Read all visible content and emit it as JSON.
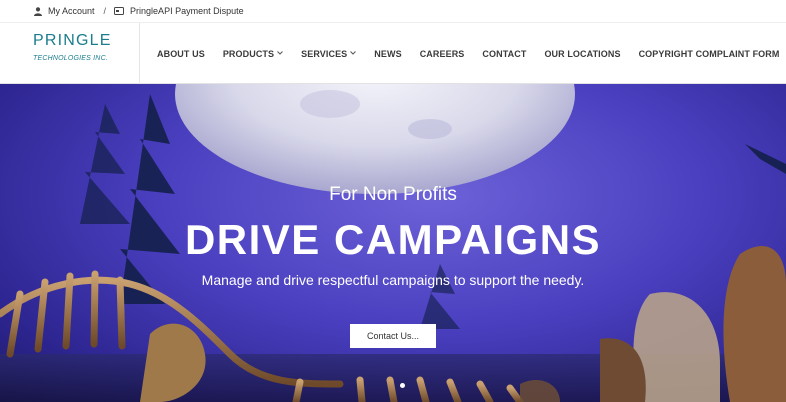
{
  "topbar": {
    "account_label": "My Account",
    "separator": "/",
    "dispute_label": "PringleAPI Payment Dispute"
  },
  "logo": {
    "brand": "PRINGLE",
    "sub": "TECHNOLOGIES INC."
  },
  "nav": {
    "items": [
      {
        "label": "ABOUT US",
        "dropdown": false
      },
      {
        "label": "PRODUCTS",
        "dropdown": true
      },
      {
        "label": "SERVICES",
        "dropdown": true
      },
      {
        "label": "NEWS",
        "dropdown": false
      },
      {
        "label": "CAREERS",
        "dropdown": false
      },
      {
        "label": "CONTACT",
        "dropdown": false
      },
      {
        "label": "OUR LOCATIONS",
        "dropdown": false
      },
      {
        "label": "COPYRIGHT COMPLAINT FORM",
        "dropdown": false
      }
    ],
    "chevron": "⌄"
  },
  "hero": {
    "eyebrow": "For Non Profits",
    "headline": "DRIVE CAMPAIGNS",
    "tagline": "Manage and drive respectful campaigns to support the needy.",
    "cta_label": "Contact Us..."
  },
  "colors": {
    "brand": "#1a7d8d",
    "hero_purple": "#4a3fbf",
    "nav_text": "#3a3a3a"
  },
  "icons": {
    "account": "user-icon",
    "dispute": "card-icon",
    "dropdown": "chevron-down-icon"
  }
}
